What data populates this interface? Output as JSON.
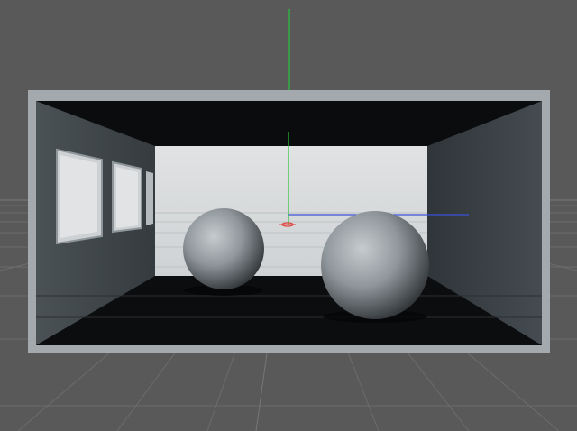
{
  "viewport": {
    "background_color": "#595959",
    "floor_grid_color": "#6a6a6a",
    "room_frame_color": "#a3a9ac",
    "room_interior_dark": "#0b0c0e",
    "room_back_wall_color": "#d5d8da",
    "room_side_wall_color": "#40474b",
    "sphere_color": "#8f969b",
    "axis_y_color": "#27c23a",
    "axis_x_color": "#e2453f",
    "axis_z_color": "#3b53d9"
  },
  "objects": [
    {
      "name": "room-box",
      "type": "box"
    },
    {
      "name": "sphere-left",
      "type": "sphere"
    },
    {
      "name": "sphere-right",
      "type": "sphere"
    }
  ],
  "icons": {
    "origin": "world-origin-icon"
  }
}
